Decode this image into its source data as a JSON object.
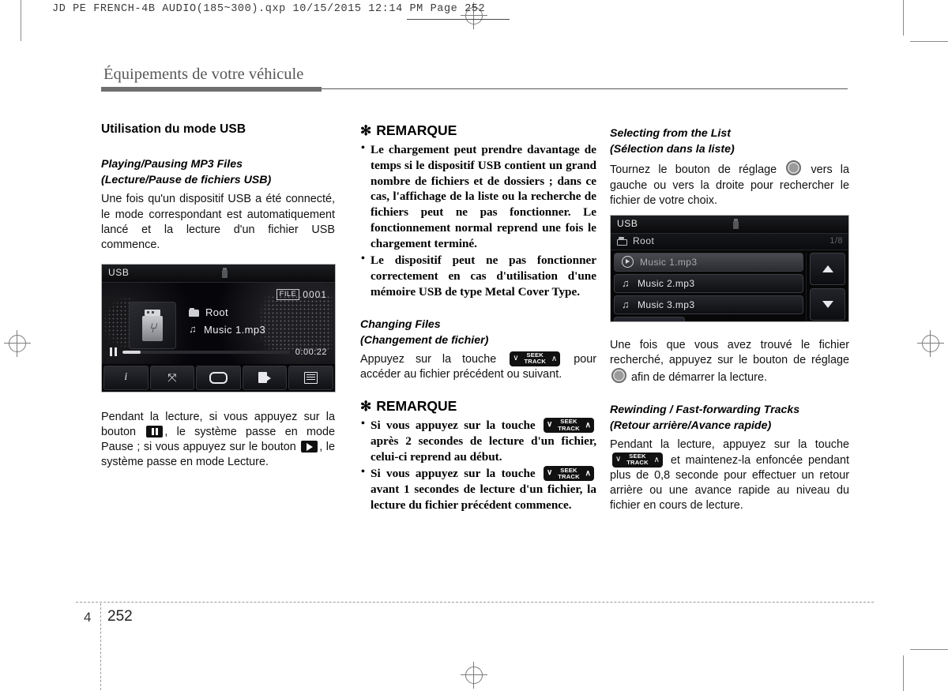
{
  "print_header": {
    "text": "JD PE FRENCH-4B AUDIO(185~300).qxp   10/15/2015   12:14 PM   Page 252"
  },
  "chapter": {
    "title": "Équipements de votre véhicule",
    "number": "4",
    "page": "252"
  },
  "column1": {
    "section_title": "Utilisation du mode USB",
    "sub_en": "Playing/Pausing MP3 Files",
    "sub_fr": "(Lecture/Pause de fichiers USB)",
    "paragraph": "Une fois qu'un dispositif USB a été connecté, le mode correspondant est automatiquement lancé et la lecture d'un fichier USB commence.",
    "after_image_1": "Pendant la lecture, si vous appuyez sur la bouton",
    "after_image_2": ", le système passe en mode Pause ; si vous appuyez sur le bouton",
    "after_image_3": ", le système passe en mode Lecture."
  },
  "player_screen": {
    "mode_label": "USB",
    "usb_icon": "usb-stick-icon",
    "file_tag": "FILE",
    "file_number": "0001",
    "folder_name": "Root",
    "track_name": "Music 1.mp3",
    "time": "0:00:22",
    "transport_state": "pause",
    "progress_percent": 11,
    "softkeys": [
      {
        "name": "info-icon",
        "glyph": "i"
      },
      {
        "name": "shuffle-icon",
        "glyph": "⤭"
      },
      {
        "name": "repeat-icon",
        "glyph": ""
      },
      {
        "name": "folder-next-icon",
        "glyph": ""
      },
      {
        "name": "list-menu-icon",
        "glyph": ""
      }
    ]
  },
  "column2": {
    "note1_title": "REMARQUE",
    "note1_star": "✻",
    "note1_items": [
      "Le chargement peut prendre davantage de temps si le dispositif USB contient un grand nombre de fichiers et de dossiers ; dans ce cas, l'affichage de la liste ou la recherche de fichiers peut ne pas fonctionner. Le fonctionnement normal reprend une fois le chargement terminé.",
      "Le dispositif peut ne pas fonctionner correctement en cas d'utilisation d'une mémoire USB de type Metal Cover Type."
    ],
    "sub_en": "Changing Files",
    "sub_fr": "(Changement de fichier)",
    "paragraph_a": "Appuyez sur la touche",
    "paragraph_b": "pour accéder au fichier précédent ou suivant.",
    "note2_title": "REMARQUE",
    "note2_star": "✻",
    "note2_item1_a": "Si vous appuyez sur la touche",
    "note2_item1_b": "après 2 secondes de lecture d'un fichier, celui-ci reprend au début.",
    "note2_item2_a": "Si vous appuyez sur la touche",
    "note2_item2_b": "avant 1 secondes de lecture d'un fichier, la lecture du fichier précédent commence."
  },
  "seek_key": {
    "line1": "SEEK",
    "line2": "TRACK",
    "left_chevron": "∨",
    "right_chevron": "∧"
  },
  "column3": {
    "sub1_en": "Selecting from the List",
    "sub1_fr": "(Sélection dans la liste)",
    "paragraph1_a": "Tournez le bouton de réglage",
    "paragraph1_b": "vers la gauche ou vers la droite pour rechercher le fichier de votre choix.",
    "paragraph2_a": "Une fois que vous avez trouvé le fichier recherché, appuyez sur le bouton de réglage",
    "paragraph2_b": "afin de démarrer la lecture.",
    "sub2_en": "Rewinding / Fast-forwarding Tracks",
    "sub2_fr": "(Retour arrière/Avance rapide)",
    "paragraph3_a": "Pendant la lecture, appuyez sur la touche",
    "paragraph3_b": "et maintenez-la enfoncée pendant plus de 0,8 seconde pour effectuer un retour arrière ou une avance rapide au niveau du fichier en cours de lecture."
  },
  "list_screen": {
    "mode_label": "USB",
    "usb_icon": "usb-stick-icon",
    "folder_name": "Root",
    "page_indicator": "1/8",
    "rows": [
      {
        "label": "Music 1.mp3",
        "icon": "play-circle-icon",
        "selected": true
      },
      {
        "label": "Music 2.mp3",
        "icon": "music-note-icon",
        "selected": false
      },
      {
        "label": "Music 3.mp3",
        "icon": "music-note-icon",
        "selected": false
      }
    ],
    "back_button": "↰",
    "scroll_up": "▲",
    "scroll_down": "▼"
  },
  "colors": {
    "title_gray": "#575757",
    "rule_dark": "#58585a",
    "device_black": "#070708",
    "knob_gray": "#9b9b9b"
  }
}
